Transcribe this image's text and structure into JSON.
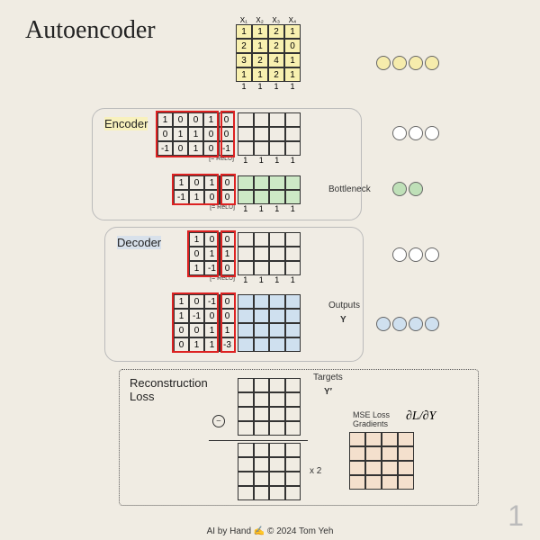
{
  "title": "Autoencoder",
  "input": {
    "headers": [
      "X₁",
      "X₂",
      "X₃",
      "X₄"
    ],
    "rows": [
      [
        "1",
        "1",
        "2",
        "1"
      ],
      [
        "2",
        "1",
        "2",
        "0"
      ],
      [
        "3",
        "2",
        "4",
        "1"
      ],
      [
        "1",
        "1",
        "2",
        "1"
      ]
    ],
    "footer": [
      "1",
      "1",
      "1",
      "1"
    ]
  },
  "encoder": {
    "label": "Encoder",
    "w1": {
      "rows": [
        [
          "1",
          "0",
          "0",
          "1",
          "0"
        ],
        [
          "0",
          "1",
          "1",
          "0",
          "0"
        ],
        [
          "-1",
          "0",
          "1",
          "0",
          "-1"
        ]
      ],
      "relu": "[= ReLU]",
      "out_footer": [
        "1",
        "1",
        "1",
        "1"
      ]
    },
    "w2": {
      "rows": [
        [
          "1",
          "0",
          "1",
          "0"
        ],
        [
          "-1",
          "1",
          "0",
          "0"
        ]
      ],
      "relu": "[= ReLU]",
      "out_footer": [
        "1",
        "1",
        "1",
        "1"
      ]
    },
    "bottleneck_label": "Bottleneck"
  },
  "decoder": {
    "label": "Decoder",
    "w1": {
      "rows": [
        [
          "1",
          "0",
          "0"
        ],
        [
          "0",
          "1",
          "1"
        ],
        [
          "1",
          "-1",
          "0"
        ]
      ],
      "relu": "[= ReLU]",
      "out_footer": [
        "1",
        "1",
        "1",
        "1"
      ]
    },
    "w2": {
      "rows": [
        [
          "1",
          "0",
          "-1",
          "0"
        ],
        [
          "1",
          "-1",
          "0",
          "0"
        ],
        [
          "0",
          "0",
          "1",
          "1"
        ],
        [
          "0",
          "1",
          "1",
          "-3"
        ]
      ]
    },
    "outputs_label": "Outputs",
    "y_label": "Y"
  },
  "loss": {
    "label": "Reconstruction\nLoss",
    "minus": "−",
    "targets_label": "Targets",
    "yprime_label": "Y′",
    "x2_label": "x 2",
    "mse_label": "MSE Loss\nGradients",
    "grad_label": "∂L/∂Y"
  },
  "circles": {
    "yellow": 4,
    "enc1": 3,
    "bottleneck": 2,
    "dec1": 3,
    "outputs": 4
  },
  "credit": "AI by Hand ✍ ©  2024 Tom Yeh",
  "page": "1"
}
